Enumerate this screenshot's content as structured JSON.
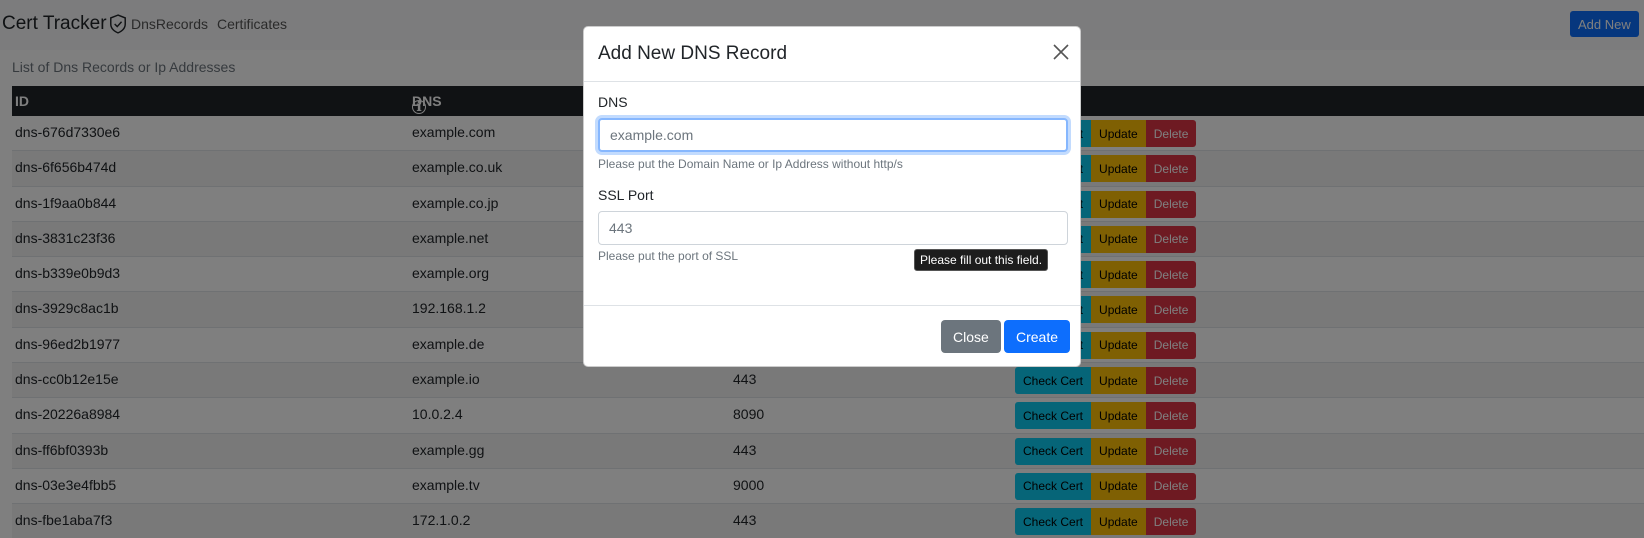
{
  "navbar": {
    "brand": "Cert Tracker",
    "links": [
      "DnsRecords",
      "Certificates"
    ],
    "add_new": "Add New"
  },
  "caption": "List of Dns Records or Ip Addresses",
  "table": {
    "headers": {
      "id": "ID",
      "dns": "DNS"
    },
    "rows": [
      {
        "id": "dns-676d7330e6",
        "dns": "example.com",
        "port": ""
      },
      {
        "id": "dns-6f656b474d",
        "dns": "example.co.uk",
        "port": ""
      },
      {
        "id": "dns-1f9aa0b844",
        "dns": "example.co.jp",
        "port": ""
      },
      {
        "id": "dns-3831c23f36",
        "dns": "example.net",
        "port": ""
      },
      {
        "id": "dns-b339e0b9d3",
        "dns": "example.org",
        "port": ""
      },
      {
        "id": "dns-3929c8ac1b",
        "dns": "192.168.1.2",
        "port": ""
      },
      {
        "id": "dns-96ed2b1977",
        "dns": "example.de",
        "port": ""
      },
      {
        "id": "dns-cc0b12e15e",
        "dns": "example.io",
        "port": "443"
      },
      {
        "id": "dns-20226a8984",
        "dns": "10.0.2.4",
        "port": "8090"
      },
      {
        "id": "dns-ff6bf0393b",
        "dns": "example.gg",
        "port": "443"
      },
      {
        "id": "dns-03e3e4fbb5",
        "dns": "example.tv",
        "port": "9000"
      },
      {
        "id": "dns-fbe1aba7f3",
        "dns": "172.1.0.2",
        "port": "443"
      }
    ],
    "actions": {
      "check": "Check Cert",
      "update": "Update",
      "delete": "Delete"
    }
  },
  "modal": {
    "title": "Add New DNS Record",
    "dns_label": "DNS",
    "dns_placeholder": "example.com",
    "dns_value": "",
    "dns_help": "Please put the Domain Name or Ip Address without http/s",
    "port_label": "SSL Port",
    "port_placeholder": "443",
    "port_value": "",
    "port_help": "Please put the port of SSL",
    "close_label": "Close",
    "create_label": "Create"
  },
  "tooltip": "Please fill out this field.",
  "colors": {
    "primary": "#0d6efd",
    "info": "#0dcaf0",
    "warning": "#ffc107",
    "danger": "#dc3545",
    "secondary": "#6c757d",
    "dark": "#212529"
  }
}
